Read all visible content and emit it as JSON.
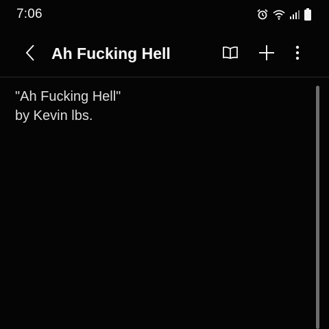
{
  "status_bar": {
    "time": "7:06",
    "icons": [
      "alarm-icon",
      "wifi-icon",
      "signal-icon",
      "battery-icon"
    ]
  },
  "app_bar": {
    "title": "Ah Fucking Hell",
    "actions": [
      "back-icon",
      "reading-mode-icon",
      "add-icon",
      "more-options-icon"
    ]
  },
  "note": {
    "lines": [
      "\"Ah Fucking Hell\"",
      "by Kevin lbs."
    ]
  },
  "colors": {
    "background": "#050505",
    "text": "#dedede",
    "title": "#f7f7f7",
    "scrollbar": "#6e6e6e"
  }
}
